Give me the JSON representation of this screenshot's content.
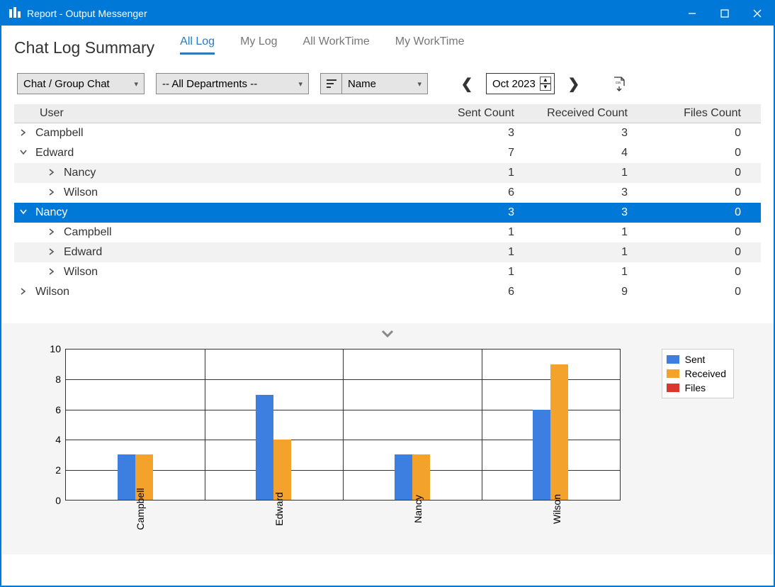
{
  "window": {
    "title": "Report - Output Messenger"
  },
  "page": {
    "title": "Chat Log Summary"
  },
  "tabs": [
    "All Log",
    "My Log",
    "All WorkTime",
    "My WorkTime"
  ],
  "active_tab": 0,
  "filters": {
    "chat_type": "Chat / Group Chat",
    "department": "-- All Departments --",
    "sort_field": "Name",
    "date": "Oct  2023"
  },
  "columns": {
    "user": "User",
    "sent": "Sent Count",
    "recv": "Received Count",
    "files": "Files Count"
  },
  "rows": [
    {
      "depth": 0,
      "expander": "right",
      "user": "Campbell",
      "sent": 3,
      "recv": 3,
      "files": 0,
      "alt": false
    },
    {
      "depth": 0,
      "expander": "down",
      "user": "Edward",
      "sent": 7,
      "recv": 4,
      "files": 0,
      "alt": false
    },
    {
      "depth": 1,
      "expander": "right",
      "user": "Nancy",
      "sent": 1,
      "recv": 1,
      "files": 0,
      "alt": true
    },
    {
      "depth": 1,
      "expander": "right",
      "user": "Wilson",
      "sent": 6,
      "recv": 3,
      "files": 0,
      "alt": false
    },
    {
      "depth": 0,
      "expander": "down",
      "user": "Nancy",
      "sent": 3,
      "recv": 3,
      "files": 0,
      "alt": false,
      "selected": true
    },
    {
      "depth": 1,
      "expander": "right",
      "user": "Campbell",
      "sent": 1,
      "recv": 1,
      "files": 0,
      "alt": false
    },
    {
      "depth": 1,
      "expander": "right",
      "user": "Edward",
      "sent": 1,
      "recv": 1,
      "files": 0,
      "alt": true
    },
    {
      "depth": 1,
      "expander": "right",
      "user": "Wilson",
      "sent": 1,
      "recv": 1,
      "files": 0,
      "alt": false
    },
    {
      "depth": 0,
      "expander": "right",
      "user": "Wilson",
      "sent": 6,
      "recv": 9,
      "files": 0,
      "alt": false
    }
  ],
  "legend": {
    "sent": "Sent",
    "recv": "Received",
    "files": "Files"
  },
  "chart_data": {
    "type": "bar",
    "categories": [
      "Campbell",
      "Edward",
      "Nancy",
      "Wilson"
    ],
    "series": [
      {
        "name": "Sent",
        "key": "sent",
        "color": "#3d7fe0",
        "values": [
          3,
          7,
          3,
          6
        ]
      },
      {
        "name": "Received",
        "key": "recv",
        "color": "#f3a22c",
        "values": [
          3,
          4,
          3,
          9
        ]
      },
      {
        "name": "Files",
        "key": "files",
        "color": "#d9362e",
        "values": [
          0,
          0,
          0,
          0
        ]
      }
    ],
    "ylim": [
      0,
      10
    ],
    "yticks": [
      0,
      2,
      4,
      6,
      8,
      10
    ],
    "title": "",
    "xlabel": "",
    "ylabel": ""
  }
}
